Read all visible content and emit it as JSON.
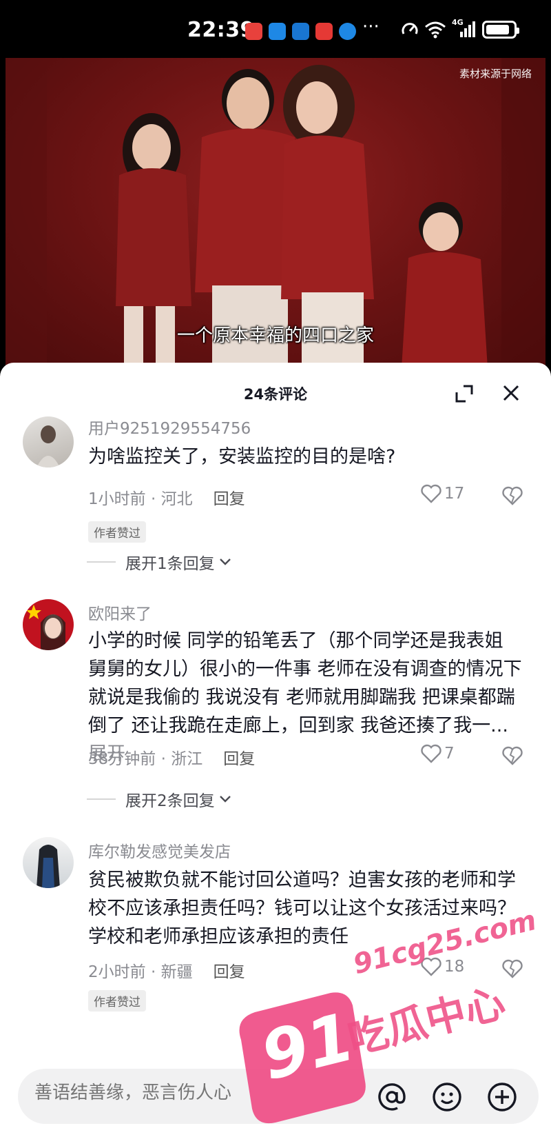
{
  "status_bar": {
    "time": "22:39",
    "app_icon_colors": [
      "#e8413c",
      "#1e88e5",
      "#1976d2",
      "#e53935",
      "#1e88e5"
    ],
    "more": "···",
    "network": "4G"
  },
  "video": {
    "watermark": "素材来源于网络",
    "subtitle": "一个原本幸福的四口之家"
  },
  "comments_panel": {
    "title": "24条评论",
    "comments": [
      {
        "user": "用户9251929554756",
        "text": "为啥监控关了，安装监控的目的是啥?",
        "time_location": "1小时前 · 河北",
        "reply_label": "回复",
        "likes": "17",
        "author_badge": "作者赞过",
        "expand_replies": "展开1条回复"
      },
      {
        "user": "欧阳来了",
        "text": "小学的时候 同学的铅笔丢了（那个同学还是我表姐 舅舅的女儿）很小的一件事 老师在没有调查的情况下 就说是我偷的 我说没有 老师就用脚踹我 把课桌都踹倒了 还让我跪在走廊上，回到家 我爸还揍了我一...",
        "expand_label": "展开",
        "time_location": "38分钟前 · 浙江",
        "reply_label": "回复",
        "likes": "7",
        "expand_replies": "展开2条回复"
      },
      {
        "user": "库尔勒发感觉美发店",
        "text": "贫民被欺负就不能讨回公道吗？迫害女孩的老师和学校不应该承担责任吗？钱可以让这个女孩活过来吗？学校和老师承担应该承担的责任",
        "time_location": "2小时前 · 新疆",
        "reply_label": "回复",
        "likes": "18",
        "author_badge": "作者赞过"
      }
    ]
  },
  "input_bar": {
    "placeholder": "善语结善缘，恶言伤人心"
  },
  "overlay_watermark": {
    "number": "91",
    "url": "91cg25.com",
    "label": "吃瓜中心",
    "color": "#ef4f86"
  }
}
